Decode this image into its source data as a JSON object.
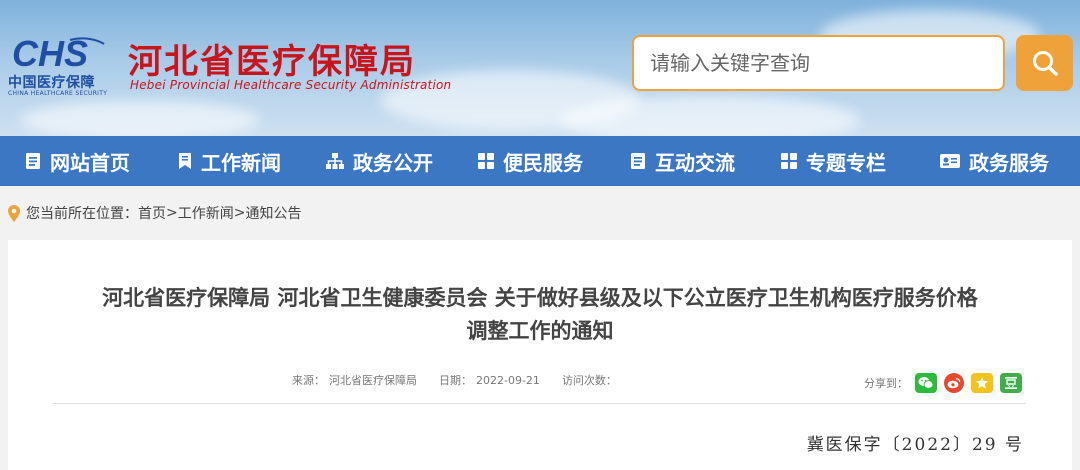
{
  "header": {
    "logo_mark": "CHS",
    "logo_cn": "中国医疗保障",
    "logo_en": "CHINA HEALTHCARE SECURITY",
    "title": "河北省医疗保障局",
    "subtitle": "Hebei Provincial Healthcare Security Administration",
    "search_placeholder": "请输入关键字查询",
    "search_icon": "search-icon"
  },
  "nav": {
    "items": [
      {
        "label": "网站首页",
        "icon": "document-icon"
      },
      {
        "label": "工作新闻",
        "icon": "bookmark-icon"
      },
      {
        "label": "政务公开",
        "icon": "sitemap-icon"
      },
      {
        "label": "便民服务",
        "icon": "grid-icon"
      },
      {
        "label": "互动交流",
        "icon": "document-icon"
      },
      {
        "label": "专题专栏",
        "icon": "grid-icon"
      },
      {
        "label": "政务服务",
        "icon": "id-card-icon"
      }
    ]
  },
  "breadcrumb": {
    "prefix": "您当前所在位置：",
    "items": [
      "首页",
      "工作新闻",
      "通知公告"
    ],
    "separator": ">"
  },
  "article": {
    "title_line1": "河北省医疗保障局 河北省卫生健康委员会 关于做好县级及以下公立医疗卫生机构医疗服务价格",
    "title_line2": "调整工作的通知",
    "source_label": "来源：",
    "source_value": "河北省医疗保障局",
    "date_label": "日期：",
    "date_value": "2022-09-21",
    "visits_label": "访问次数：",
    "share_label": "分享到：",
    "doc_number": "冀医保字〔2022〕29 号"
  },
  "colors": {
    "nav_bg": "#3b77c2",
    "title_red": "#c9141b",
    "accent_orange": "#f0a23a",
    "wechat_green": "#2dbb3a",
    "weibo_red": "#e6492e",
    "qzone_yellow": "#f2c31d",
    "douban_green": "#3fae49"
  }
}
